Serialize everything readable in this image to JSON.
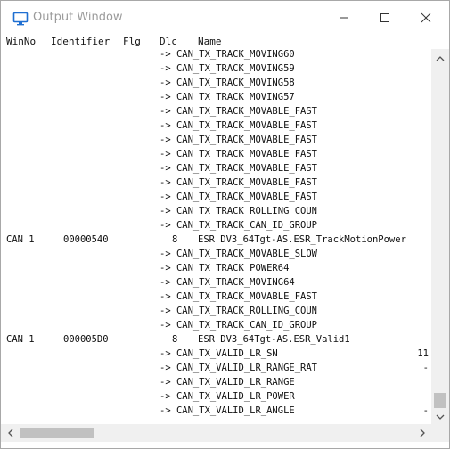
{
  "window": {
    "title": "Output Window",
    "icon": "monitor-icon",
    "controls": {
      "minimize": "minimize-icon",
      "maximize": "maximize-icon",
      "close": "close-icon"
    }
  },
  "columns": {
    "winno": "WinNo",
    "identifier": "Identifier",
    "flg": "Flg",
    "dlc": "Dlc",
    "name": "Name"
  },
  "rows": [
    {
      "kind": "sig",
      "text": "-> CAN_TX_TRACK_MOVING60",
      "tail": ""
    },
    {
      "kind": "sig",
      "text": "-> CAN_TX_TRACK_MOVING59",
      "tail": ""
    },
    {
      "kind": "sig",
      "text": "-> CAN_TX_TRACK_MOVING58",
      "tail": ""
    },
    {
      "kind": "sig",
      "text": "-> CAN_TX_TRACK_MOVING57",
      "tail": ""
    },
    {
      "kind": "sig",
      "text": "-> CAN_TX_TRACK_MOVABLE_FAST",
      "tail": ""
    },
    {
      "kind": "sig",
      "text": "-> CAN_TX_TRACK_MOVABLE_FAST",
      "tail": ""
    },
    {
      "kind": "sig",
      "text": "-> CAN_TX_TRACK_MOVABLE_FAST",
      "tail": ""
    },
    {
      "kind": "sig",
      "text": "-> CAN_TX_TRACK_MOVABLE_FAST",
      "tail": ""
    },
    {
      "kind": "sig",
      "text": "-> CAN_TX_TRACK_MOVABLE_FAST",
      "tail": ""
    },
    {
      "kind": "sig",
      "text": "-> CAN_TX_TRACK_MOVABLE_FAST",
      "tail": ""
    },
    {
      "kind": "sig",
      "text": "-> CAN_TX_TRACK_MOVABLE_FAST",
      "tail": ""
    },
    {
      "kind": "sig",
      "text": "-> CAN_TX_TRACK_ROLLING_COUN",
      "tail": ""
    },
    {
      "kind": "sig",
      "text": "-> CAN_TX_TRACK_CAN_ID_GROUP",
      "tail": ""
    },
    {
      "kind": "msg",
      "win": "CAN 1",
      "id": "00000540",
      "dlc": "8",
      "name": "ESR DV3_64Tgt-AS.ESR_TrackMotionPower"
    },
    {
      "kind": "sig",
      "text": "-> CAN_TX_TRACK_MOVABLE_SLOW",
      "tail": ""
    },
    {
      "kind": "sig",
      "text": "-> CAN_TX_TRACK_POWER64",
      "tail": ""
    },
    {
      "kind": "sig",
      "text": "-> CAN_TX_TRACK_MOVING64",
      "tail": ""
    },
    {
      "kind": "sig",
      "text": "-> CAN_TX_TRACK_MOVABLE_FAST",
      "tail": ""
    },
    {
      "kind": "sig",
      "text": "-> CAN_TX_TRACK_ROLLING_COUN",
      "tail": ""
    },
    {
      "kind": "sig",
      "text": "-> CAN_TX_TRACK_CAN_ID_GROUP",
      "tail": ""
    },
    {
      "kind": "msg",
      "win": "CAN 1",
      "id": "000005D0",
      "dlc": "8",
      "name": "ESR DV3_64Tgt-AS.ESR_Valid1"
    },
    {
      "kind": "sig",
      "text": "-> CAN_TX_VALID_LR_SN",
      "tail": "11"
    },
    {
      "kind": "sig",
      "text": "-> CAN_TX_VALID_LR_RANGE_RAT",
      "tail": "-"
    },
    {
      "kind": "sig",
      "text": "-> CAN_TX_VALID_LR_RANGE",
      "tail": ""
    },
    {
      "kind": "sig",
      "text": "-> CAN_TX_VALID_LR_POWER",
      "tail": ""
    },
    {
      "kind": "sig",
      "text": "-> CAN_TX_VALID_LR_ANGLE",
      "tail": "-"
    }
  ],
  "scrollbars": {
    "up": "chevron-up-icon",
    "down": "chevron-down-icon",
    "left": "chevron-left-icon",
    "right": "chevron-right-icon"
  }
}
